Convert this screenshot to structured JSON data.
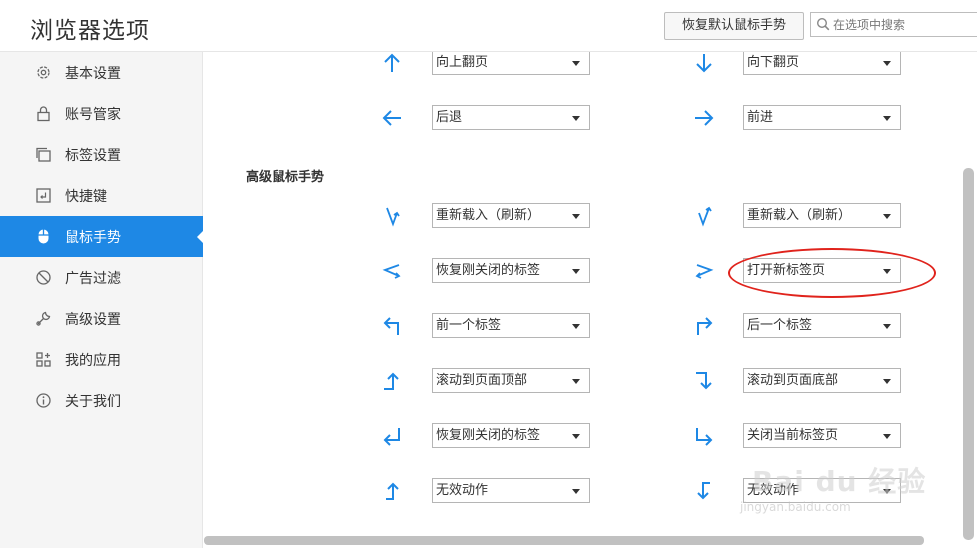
{
  "header": {
    "title": "浏览器选项",
    "reset_button": "恢复默认鼠标手势",
    "search_placeholder": "在选项中搜索"
  },
  "sidebar": {
    "items": [
      {
        "label": "基本设置",
        "icon": "gear-icon",
        "active": false
      },
      {
        "label": "账号管家",
        "icon": "lock-icon",
        "active": false
      },
      {
        "label": "标签设置",
        "icon": "tabs-icon",
        "active": false
      },
      {
        "label": "快捷键",
        "icon": "keyboard-icon",
        "active": false
      },
      {
        "label": "鼠标手势",
        "icon": "mouse-icon",
        "active": true
      },
      {
        "label": "广告过滤",
        "icon": "block-icon",
        "active": false
      },
      {
        "label": "高级设置",
        "icon": "wrench-icon",
        "active": false
      },
      {
        "label": "我的应用",
        "icon": "apps-icon",
        "active": false
      },
      {
        "label": "关于我们",
        "icon": "info-icon",
        "active": false
      }
    ]
  },
  "basic_gestures": [
    {
      "gesture": "up-arrow-icon",
      "action": "向上翻页"
    },
    {
      "gesture": "down-arrow-icon",
      "action": "向下翻页"
    },
    {
      "gesture": "left-arrow-icon",
      "action": "后退"
    },
    {
      "gesture": "right-arrow-icon",
      "action": "前进"
    }
  ],
  "advanced": {
    "title": "高级鼠标手势",
    "gestures": [
      {
        "gesture": "down-up-gesture-icon",
        "action": "重新载入（刷新）"
      },
      {
        "gesture": "up-down-gesture-icon",
        "action": "重新载入（刷新）"
      },
      {
        "gesture": "left-right-gesture-icon",
        "action": "恢复刚关闭的标签"
      },
      {
        "gesture": "right-left-gesture-icon",
        "action": "打开新标签页"
      },
      {
        "gesture": "up-left-gesture-icon",
        "action": "前一个标签"
      },
      {
        "gesture": "up-right-gesture-icon",
        "action": "后一个标签"
      },
      {
        "gesture": "left-up-gesture-icon",
        "action": "滚动到页面顶部"
      },
      {
        "gesture": "right-down-gesture-icon",
        "action": "滚动到页面底部"
      },
      {
        "gesture": "down-left-gesture-icon",
        "action": "恢复刚关闭的标签"
      },
      {
        "gesture": "down-right-gesture-icon",
        "action": "关闭当前标签页"
      },
      {
        "gesture": "left-up-alt-gesture-icon",
        "action": "无效动作"
      },
      {
        "gesture": "right-down-alt-gesture-icon",
        "action": "无效动作"
      }
    ]
  },
  "watermark": {
    "brand": "Bai du 经验",
    "site": "jingyan.baidu.com"
  },
  "colors": {
    "accent": "#1e88e5",
    "highlight": "#e0231c"
  }
}
